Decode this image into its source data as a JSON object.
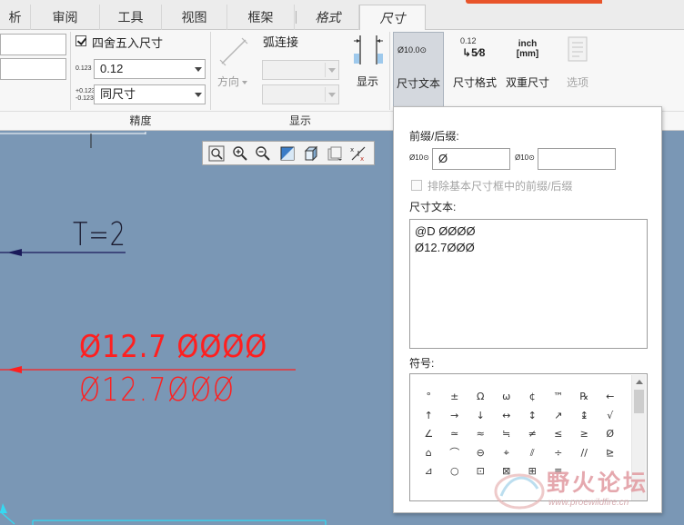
{
  "tabs": {
    "analysis": "析",
    "review": "审阅",
    "tools": "工具",
    "view": "视图",
    "frame": "框架",
    "format": "格式",
    "dimension": "尺寸"
  },
  "ribbon": {
    "round_checkbox_label": "四舍五入尺寸",
    "round_checked": true,
    "decimal_icon_text": "0.123",
    "tolerance_icon_top": "+0.123",
    "tolerance_icon_bottom": "-0.123",
    "decimal_value": "0.12",
    "tolerance_value": "同尺寸",
    "precision_group": "精度",
    "arc_connection_label": "弧连接",
    "direction_label": "方向",
    "display_small_label": "显示",
    "display_group": "显示",
    "dim_text_label": "尺寸文本",
    "dim_text_icon": "Ø10.0⊙",
    "dim_format_label": "尺寸格式",
    "dim_format_top": "0.12",
    "dim_format_frac": "5⁄8",
    "dual_dim_label": "双重尺寸",
    "dual_dim_top": "inch",
    "dual_dim_bottom": "[mm]",
    "options_label": "选项"
  },
  "canvas": {
    "label_t": "T=2",
    "dim_line_upper": "Ø12.7 ØØØØ",
    "dim_line_lower": "Ø12.7ØØØ",
    "colors": {
      "background": "#7a97b5",
      "dim_red": "#ff1f1f",
      "arrow_blue": "#1a1a5a"
    }
  },
  "panel": {
    "prefix_suffix_label": "前缀/后缀:",
    "prefix_icon": "Ø10⊙",
    "prefix_value": "Ø",
    "suffix_icon": "Ø10⊙",
    "suffix_value": "",
    "exclude_checkbox_label": "排除基本尺寸框中的前缀/后缀",
    "dim_text_label": "尺寸文本:",
    "dim_text_value": "@D ØØØØ\nØ12.7ØØØ",
    "symbols_label": "符号:",
    "symbols": [
      "°",
      "±",
      "Ω",
      "ω",
      "¢",
      "™",
      "℞",
      "←",
      "↑",
      "→",
      "↓",
      "↔",
      "↕",
      "↗",
      "↨",
      "√",
      "∠",
      "≃",
      "≈",
      "≒",
      "≠",
      "≤",
      "≥",
      "Ø",
      "⌂",
      "⌒",
      "⊖",
      "⌖",
      "⫽",
      "÷",
      "//",
      "⊵",
      "⊿",
      "○",
      "⊡",
      "⊠",
      "⊞",
      "≡"
    ]
  },
  "watermark": {
    "text": "野火论坛",
    "url": "www.proewildfire.cn"
  }
}
